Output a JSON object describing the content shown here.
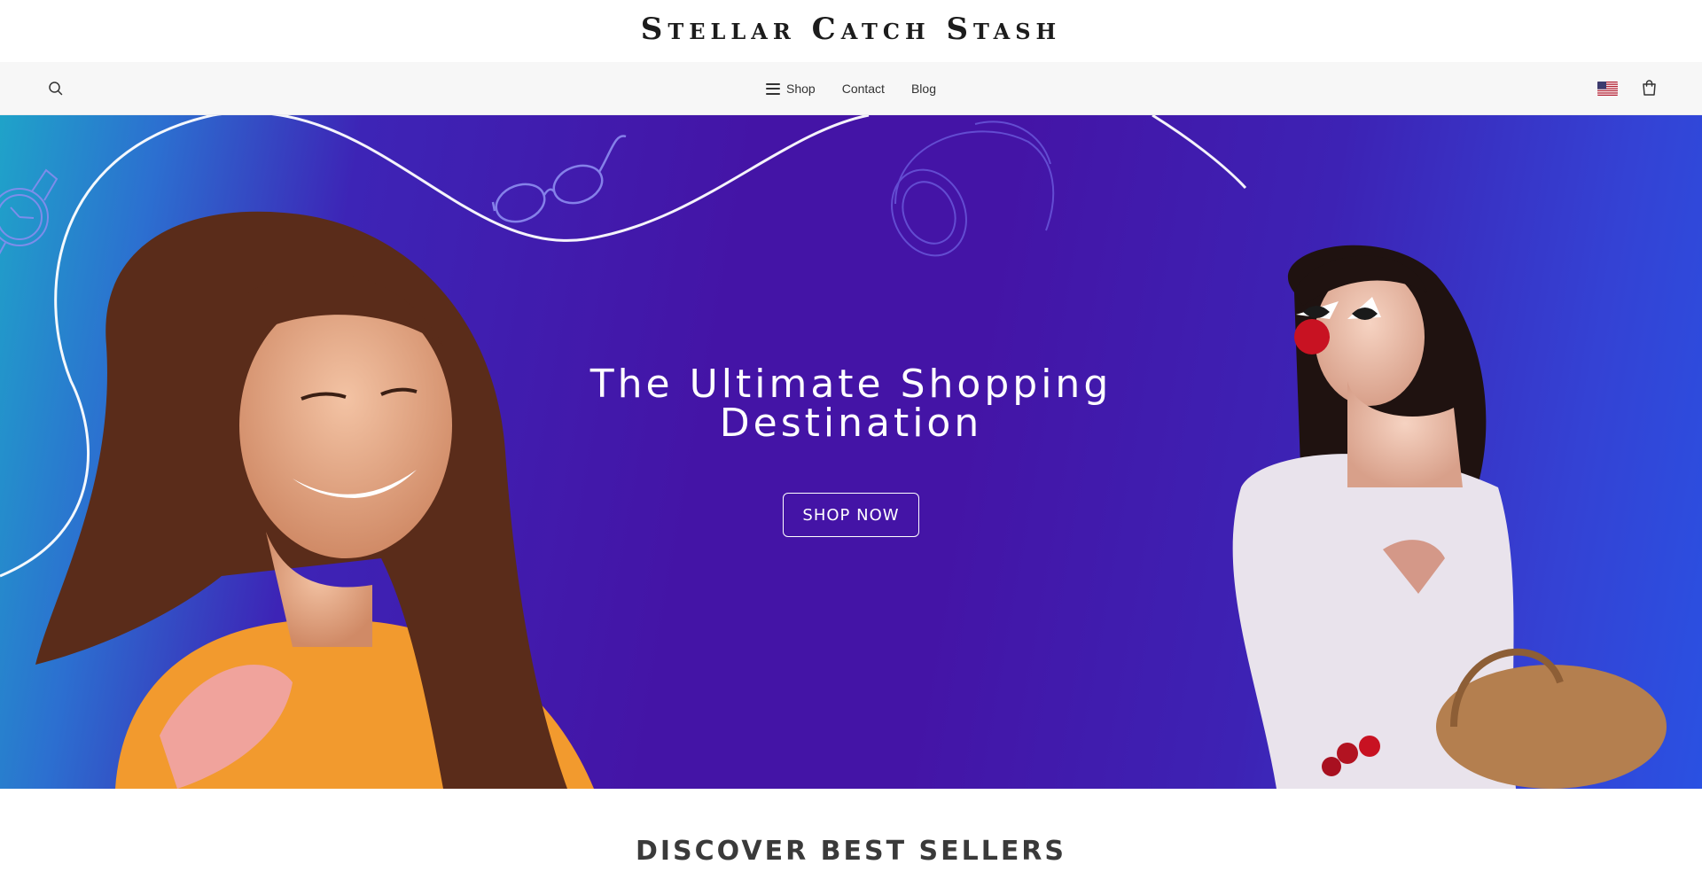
{
  "brand": {
    "title": "Stellar Catch Stash"
  },
  "nav": {
    "search_icon": "search-icon",
    "links": [
      {
        "label": "Shop",
        "icon": "menu-icon"
      },
      {
        "label": "Contact"
      },
      {
        "label": "Blog"
      }
    ],
    "flag_icon": "us-flag-icon",
    "cart_icon": "shopping-bag-icon"
  },
  "hero": {
    "headline_line1": "The Ultimate Shopping",
    "headline_line2": "Destination",
    "cta_label": "SHOP NOW",
    "colors": {
      "gradient_left": "#1fa3c9",
      "gradient_center": "#4414a6",
      "gradient_right": "#2a51e2"
    }
  },
  "best_sellers": {
    "title": "DISCOVER BEST SELLERS"
  }
}
